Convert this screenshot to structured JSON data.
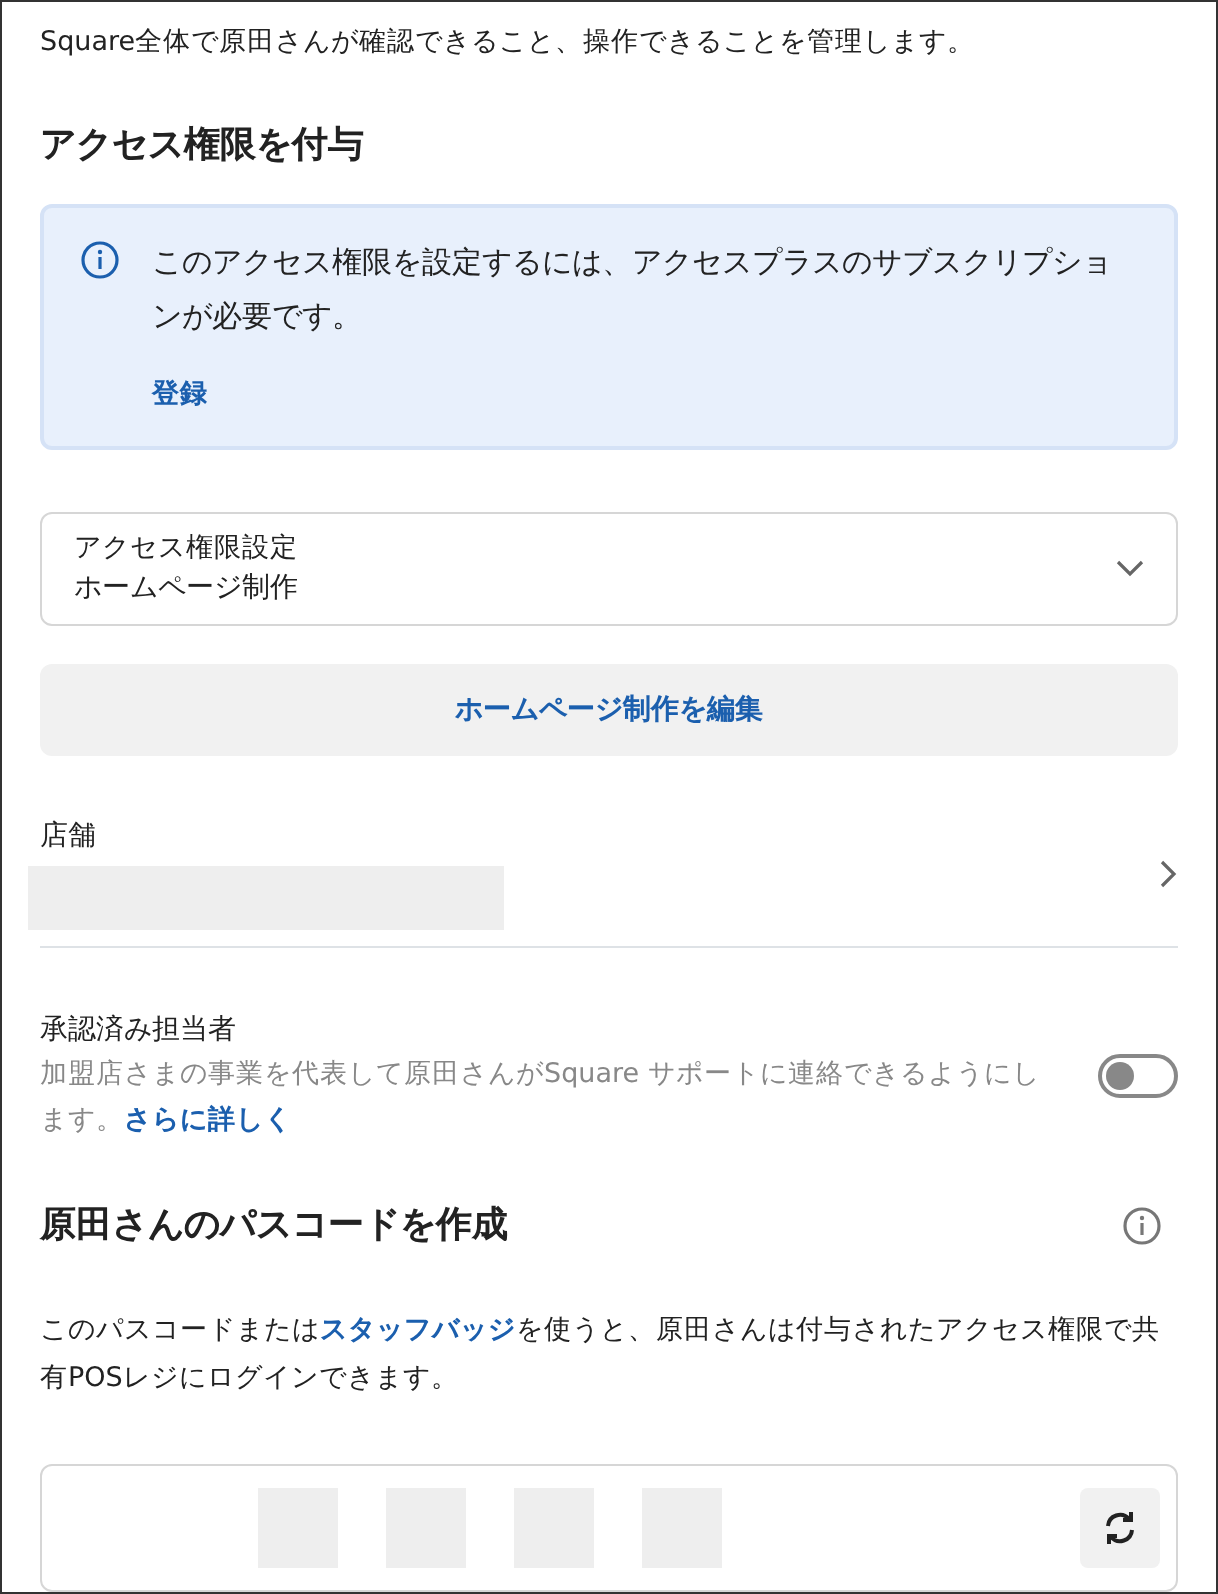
{
  "intro": "Square全体で原田さんが確認できること、操作できることを管理します。",
  "access": {
    "heading": "アクセス権限を付与",
    "notice": {
      "text": "このアクセス権限を設定するには、アクセスプラスのサブスクリプションが必要です。",
      "link": "登録"
    },
    "select": {
      "label": "アクセス権限設定",
      "value": "ホームページ制作"
    },
    "edit_button": "ホームページ制作を編集"
  },
  "store": {
    "label": "店舗"
  },
  "approved": {
    "label": "承認済み担当者",
    "description": "加盟店さまの事業を代表して原田さんがSquare サポートに連絡できるようにします。",
    "link": "さらに詳しく",
    "on": false
  },
  "passcode": {
    "heading": "原田さんのパスコードを作成",
    "text_before": "このパスコードまたは",
    "link": "スタッフバッジ",
    "text_after": "を使うと、原田さんは付与されたアクセス権限で共有POSレジにログインできます。"
  }
}
